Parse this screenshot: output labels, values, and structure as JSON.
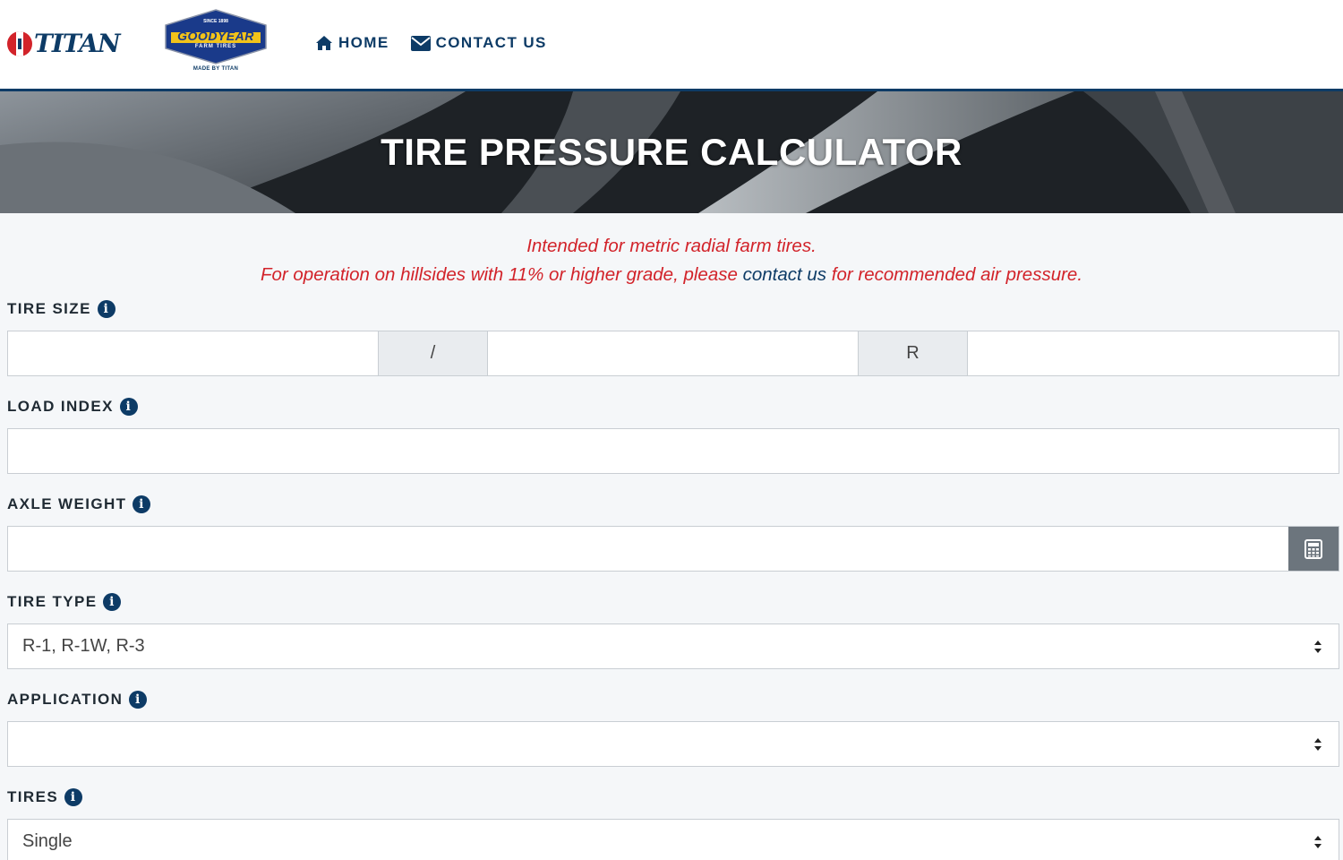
{
  "header": {
    "titan_logo_text": "TITAN",
    "goodyear_logo": {
      "top_text": "SINCE 1898",
      "main_text": "GOODYEAR",
      "sub_text": "FARM TIRES",
      "made_by": "MADE BY TITAN"
    },
    "nav": {
      "home_label": "HOME",
      "contact_label": "CONTACT US"
    }
  },
  "hero": {
    "title": "TIRE PRESSURE CALCULATOR"
  },
  "notice": {
    "line1": "Intended for metric radial farm tires.",
    "line2_before": "For operation on hillsides with 11% or higher grade, please ",
    "line2_link": "contact us",
    "line2_after": " for recommended air pressure."
  },
  "form": {
    "tire_size": {
      "label": "TIRE SIZE",
      "width_value": "",
      "separator": "/",
      "aspect_value": "",
      "construction": "R",
      "rim_value": ""
    },
    "load_index": {
      "label": "LOAD INDEX",
      "value": ""
    },
    "axle_weight": {
      "label": "AXLE WEIGHT",
      "value": ""
    },
    "tire_type": {
      "label": "TIRE TYPE",
      "selected": "R-1, R-1W, R-3"
    },
    "application": {
      "label": "APPLICATION",
      "selected": ""
    },
    "tires": {
      "label": "TIRES",
      "selected": "Single"
    }
  },
  "colors": {
    "brand_navy": "#0d3b66",
    "notice_red": "#d2232a",
    "page_bg": "#f5f7f9",
    "calc_button_gray": "#6c757d"
  }
}
